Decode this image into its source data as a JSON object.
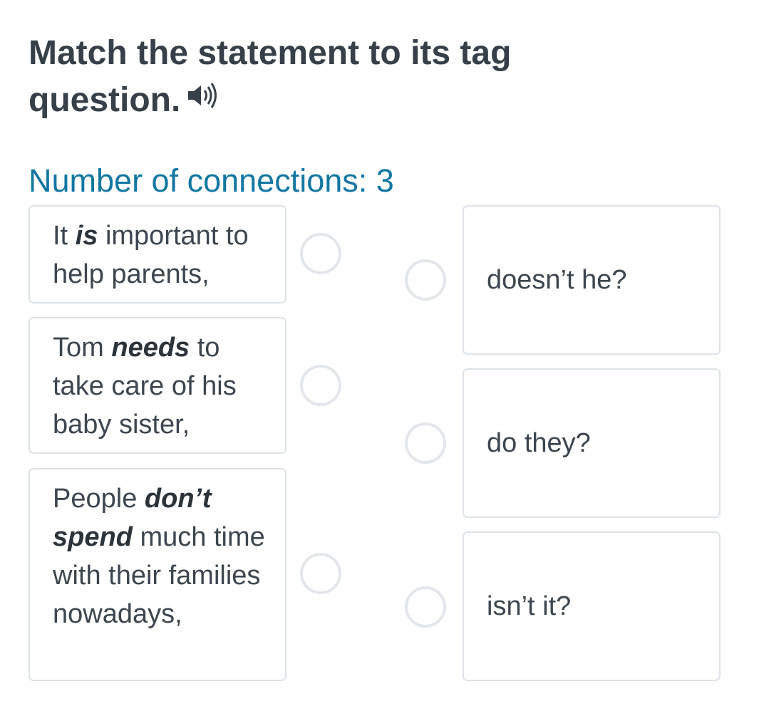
{
  "title": "Match the statement to its tag question.",
  "connections_text": "Number of connections: 3",
  "statements": [
    {
      "parts": [
        {
          "t": "It ",
          "e": false
        },
        {
          "t": "is",
          "e": true
        },
        {
          "t": " important to help parents,",
          "e": false
        }
      ]
    },
    {
      "parts": [
        {
          "t": "Tom ",
          "e": false
        },
        {
          "t": "needs",
          "e": true
        },
        {
          "t": " to take care of his baby sister,",
          "e": false
        }
      ]
    },
    {
      "parts": [
        {
          "t": "People ",
          "e": false
        },
        {
          "t": "don’t spend",
          "e": true
        },
        {
          "t": " much time with their families nowadays,",
          "e": false
        }
      ]
    }
  ],
  "tags": [
    {
      "label": "doesn’t he?"
    },
    {
      "label": "do they?"
    },
    {
      "label": "isn’t it?"
    }
  ],
  "icons": {
    "audio": "speaker-icon"
  },
  "colors": {
    "accent": "#1277a3",
    "border": "#dde3e8",
    "text": "#3d4650"
  }
}
